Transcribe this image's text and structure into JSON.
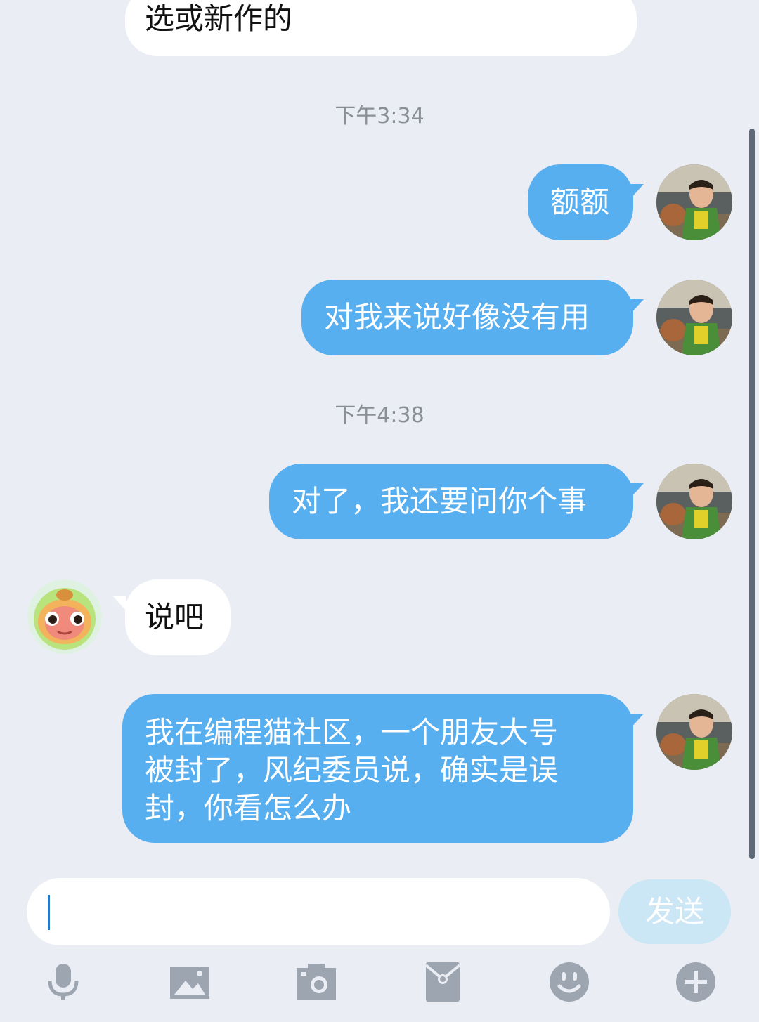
{
  "messages": {
    "m0": {
      "text": "选或新作的"
    },
    "ts1": "下午3:34",
    "m1": {
      "text": "额额"
    },
    "m2": {
      "text": "对我来说好像没有用"
    },
    "ts2": "下午4:38",
    "m3": {
      "text": "对了，我还要问你个事"
    },
    "m4": {
      "text": "说吧"
    },
    "m5": {
      "line1": "我在编程猫社区，一个朋友大号",
      "line2": "被封了，风纪委员说，确实是误",
      "line3": "封，你看怎么办"
    }
  },
  "composer": {
    "value": "",
    "send_label": "发送"
  },
  "toolbar": {
    "icons": [
      "microphone-icon",
      "image-icon",
      "camera-icon",
      "red-packet-icon",
      "emoji-icon",
      "plus-icon"
    ]
  },
  "colors": {
    "outgoing_bubble": "#58aff0",
    "incoming_bubble": "#ffffff",
    "background": "#eaeef4"
  }
}
